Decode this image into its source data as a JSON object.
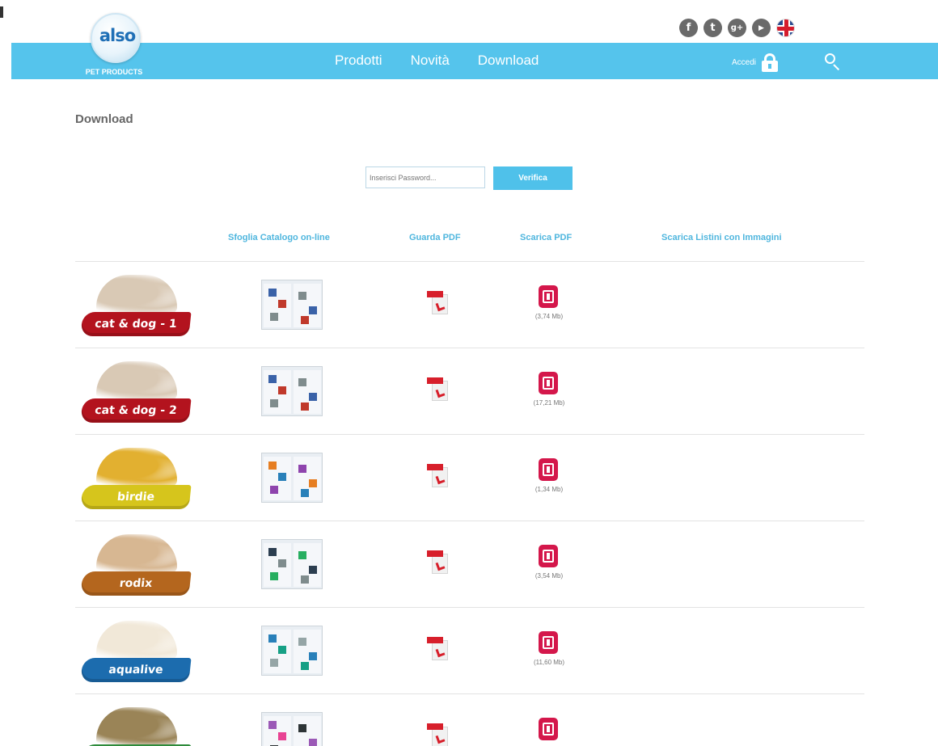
{
  "brand": {
    "logo_text": "also",
    "logo_sub": "PET PRODUCTS"
  },
  "colors": {
    "nav": "#55c4ec",
    "accent": "#4fc1ea",
    "download_red": "#d4174b",
    "pdf_red": "#d71f2b"
  },
  "social": [
    {
      "icon": "facebook-icon",
      "glyph": "f"
    },
    {
      "icon": "twitter-icon",
      "glyph": "t"
    },
    {
      "icon": "google-plus-icon",
      "glyph": "g+"
    },
    {
      "icon": "youtube-icon",
      "glyph": "▶"
    },
    {
      "icon": "uk-flag-icon",
      "glyph": ""
    }
  ],
  "nav": {
    "items": [
      "Prodotti",
      "Novità",
      "Download"
    ],
    "login_label": "Accedi"
  },
  "page": {
    "title": "Download"
  },
  "password": {
    "placeholder": "Inserisci Password...",
    "button": "Verifica"
  },
  "table": {
    "headers": [
      "Sfoglia Catalogo on-line",
      "Guarda PDF",
      "Scarica PDF",
      "Scarica Listini con Immagini"
    ],
    "rows": [
      {
        "label": "cat & dog - 1",
        "size": "(3,74 Mb)",
        "ribbon": "#b3131e",
        "art": "#d9c9b5"
      },
      {
        "label": "cat & dog - 2",
        "size": "(17,21 Mb)",
        "ribbon": "#b3131e",
        "art": "#d9c9b5"
      },
      {
        "label": "birdie",
        "size": "(1,34 Mb)",
        "ribbon": "#d6c51c",
        "art": "#e2b030"
      },
      {
        "label": "rodix",
        "size": "(3,54 Mb)",
        "ribbon": "#b4661e",
        "art": "#d7b792"
      },
      {
        "label": "aqualive",
        "size": "(11,60 Mb)",
        "ribbon": "#1c6cae",
        "art": "#f1e8d8"
      },
      {
        "label": "",
        "size": "",
        "ribbon": "#2e8b3b",
        "art": "#9a8457"
      }
    ]
  }
}
